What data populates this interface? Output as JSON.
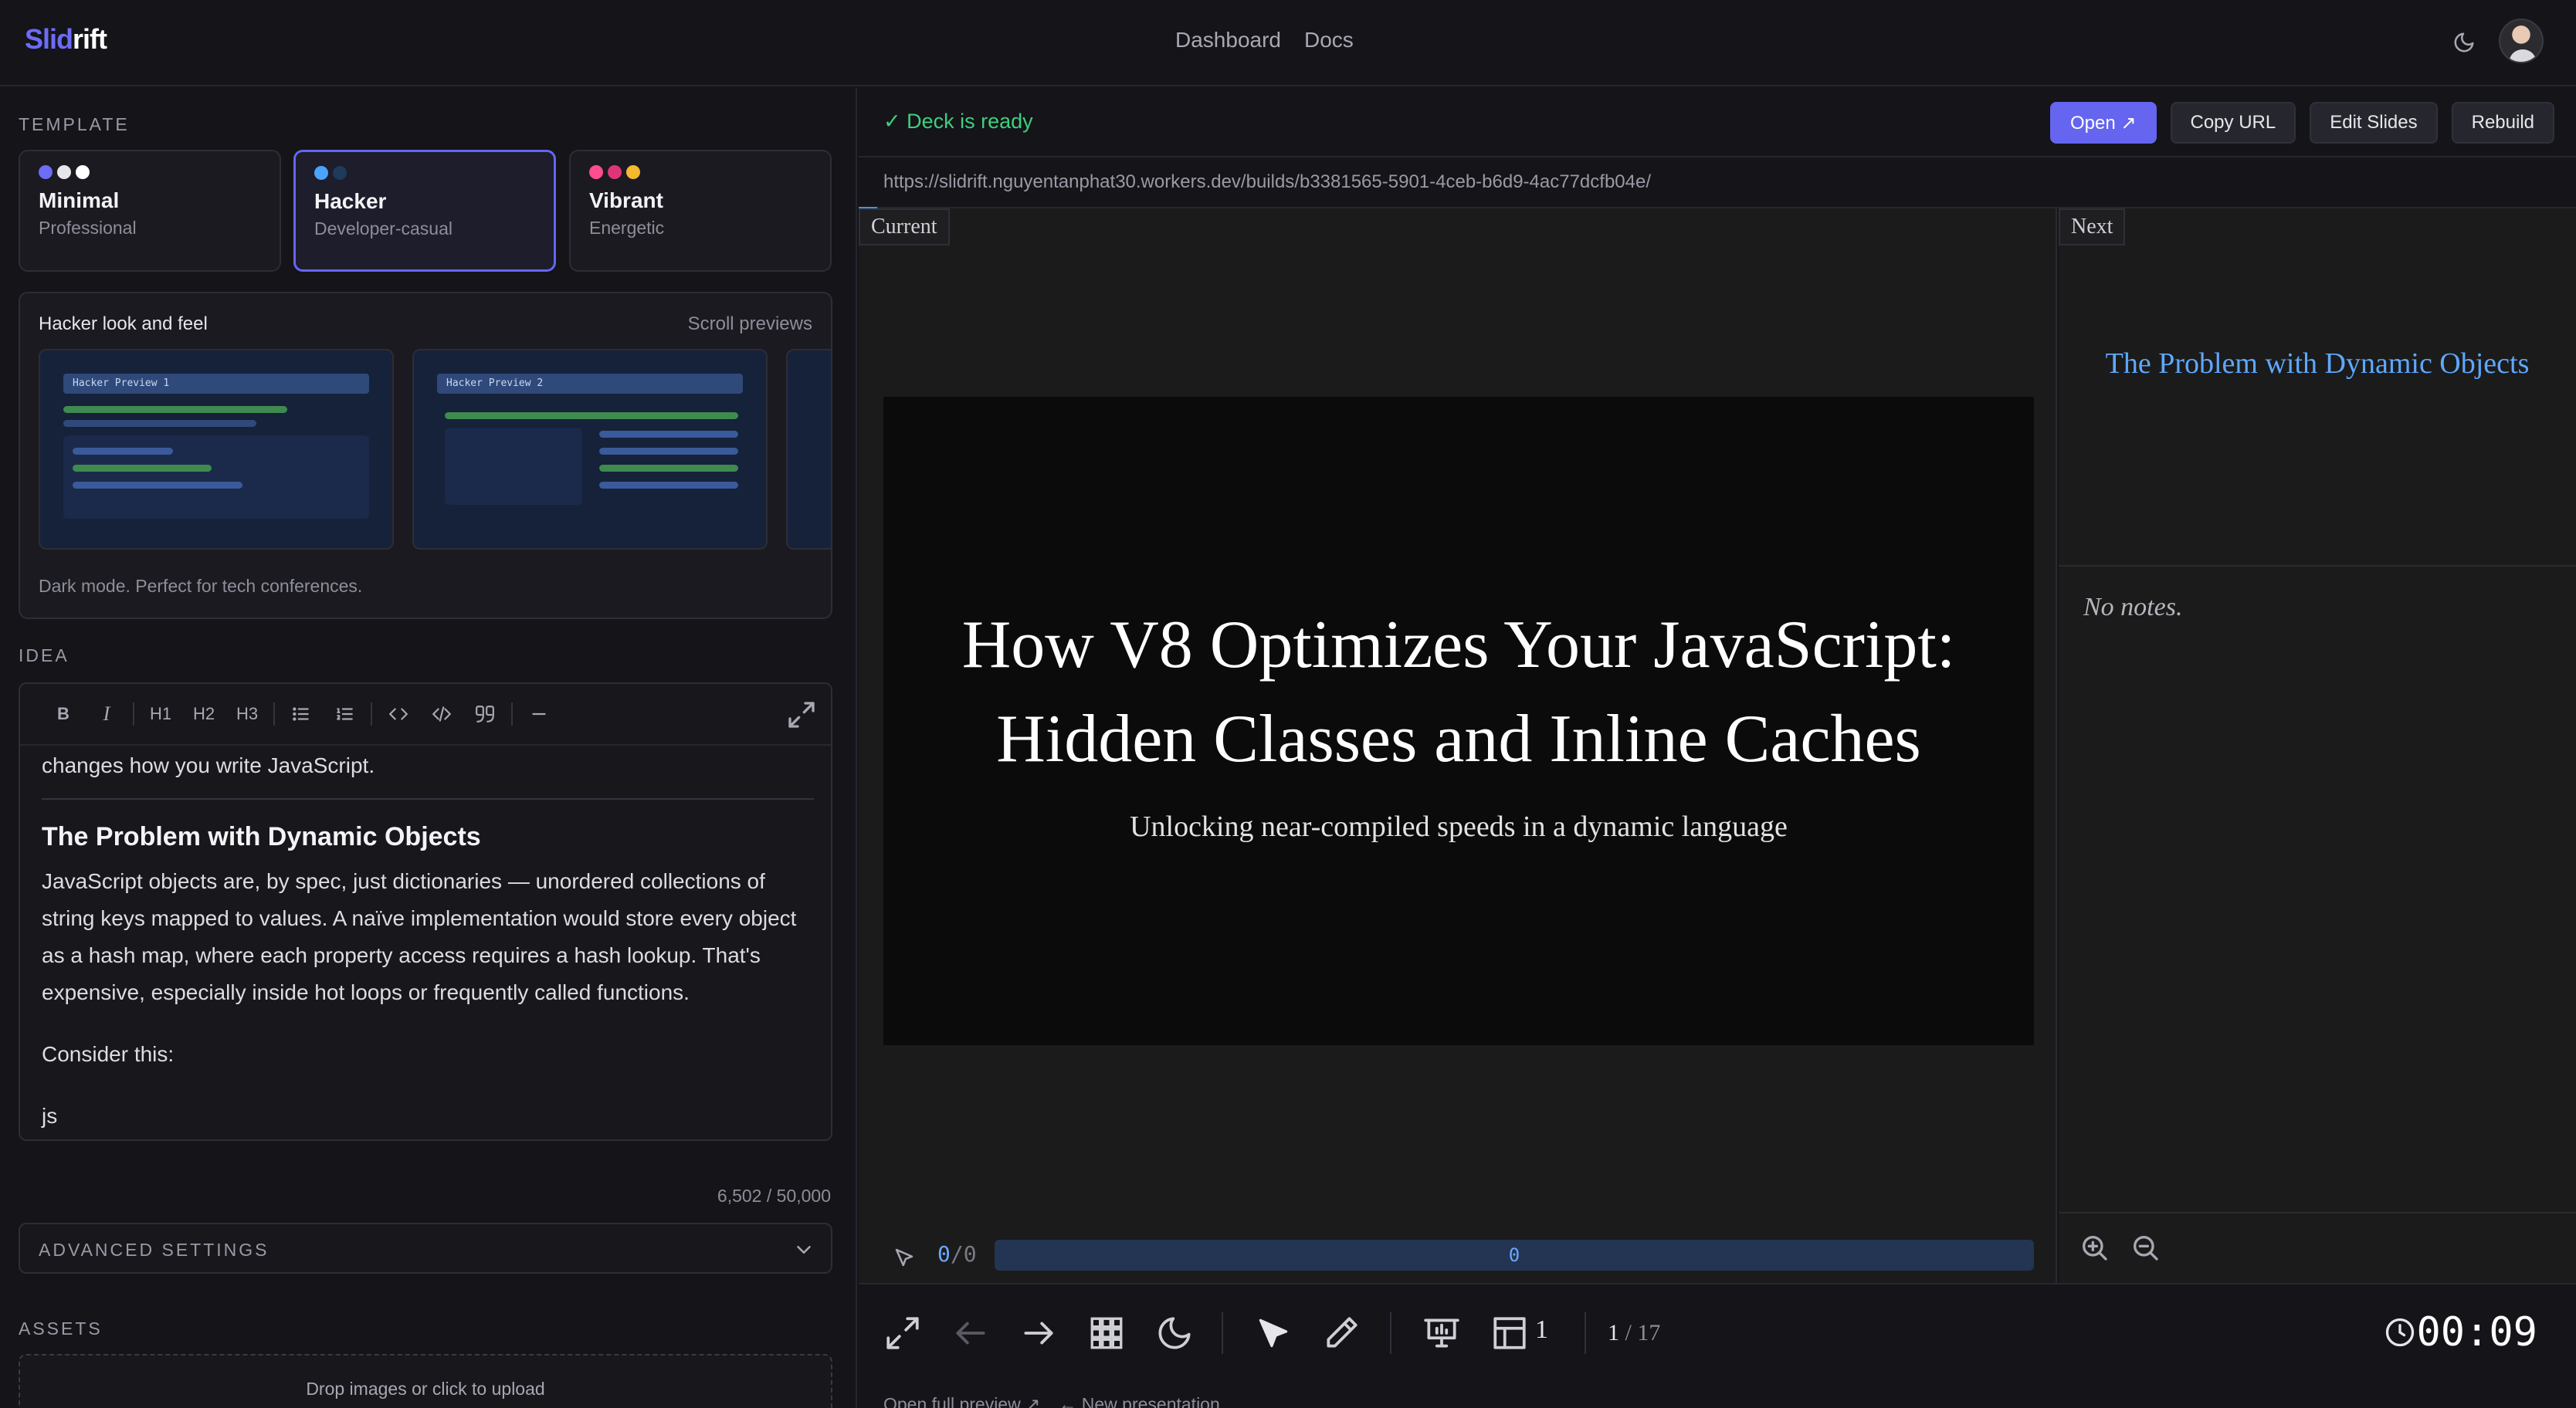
{
  "app": {
    "logo_a": "Slid",
    "logo_b": "rift"
  },
  "nav": {
    "dashboard": "Dashboard",
    "docs": "Docs"
  },
  "left": {
    "template_label": "TEMPLATE",
    "templates": [
      {
        "name": "Minimal",
        "sub": "Professional",
        "dots": [
          "#6c6cf5",
          "#e6e6ea",
          "#ffffff"
        ]
      },
      {
        "name": "Hacker",
        "sub": "Developer-casual",
        "dots": [
          "#4aa3ff",
          "#1f3a5a",
          "#1d1d2b"
        ]
      },
      {
        "name": "Vibrant",
        "sub": "Energetic",
        "dots": [
          "#ff4d8d",
          "#e0347a",
          "#f5b82e"
        ]
      }
    ],
    "look": {
      "title": "Hacker look and feel",
      "scroll": "Scroll previews",
      "preview1": "Hacker Preview 1",
      "preview2": "Hacker Preview 2",
      "desc": "Dark mode. Perfect for tech conferences."
    },
    "idea_label": "IDEA",
    "editor": {
      "toolbar": [
        "B",
        "I",
        "H1",
        "H2",
        "H3"
      ],
      "line1": "changes how you write JavaScript.",
      "heading": "The Problem with Dynamic Objects",
      "para": "JavaScript objects are, by spec, just dictionaries — unordered collections of string keys mapped to values. A naïve implementation would store every object as a hash map, where each property access requires a hash lookup. That's expensive, especially inside hot loops or frequently called functions.",
      "consider": "Consider this:",
      "js": "js"
    },
    "counter": "6,502 / 50,000",
    "advanced": "ADVANCED SETTINGS",
    "assets_label": "ASSETS",
    "drop": "Drop images or click to upload"
  },
  "right": {
    "status": "✓ Deck is ready",
    "buttons": {
      "open": "Open ↗",
      "copy": "Copy URL",
      "edit": "Edit Slides",
      "rebuild": "Rebuild"
    },
    "url": "https://slidrift.nguyentanphat30.workers.dev/builds/b3381565-5901-4ceb-b6d9-4ac77dcfb04e/",
    "current_label": "Current",
    "next_label": "Next",
    "slide": {
      "title": "How V8 Optimizes Your JavaScript: Hidden Classes and Inline Caches",
      "subtitle": "Unlocking near-compiled speeds in a dynamic language"
    },
    "ctrl": {
      "num": "0",
      "den": "0",
      "track": "0"
    },
    "next_title": "The Problem with Dynamic Objects",
    "notes": "No notes.",
    "layout_num": "1",
    "page": {
      "current": "1",
      "total": "17"
    },
    "timer": "00:09",
    "footer": {
      "open_full": "Open full preview ↗",
      "new": "← New presentation"
    }
  }
}
